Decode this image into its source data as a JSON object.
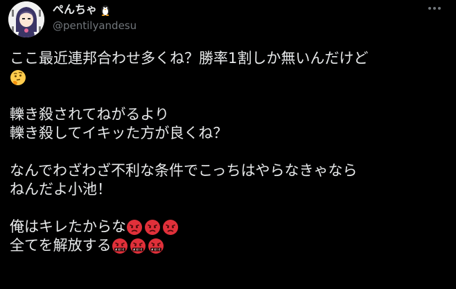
{
  "author": {
    "display_name": "ぺんちゃ",
    "handle": "@pentilyandesu"
  },
  "icons": {
    "penguin": "penguin-emoji",
    "more": "more-options-icon",
    "thinking": "thinking-face-emoji",
    "angry": "angry-face-emoji",
    "cursing": "face-with-symbols-on-mouth-emoji"
  },
  "tweet": {
    "line1": "ここ最近連邦合わせ多くね？勝率1割しか無いんだけど",
    "line2": "轢き殺されてねがるより",
    "line3": "轢き殺してイキッた方が良くね？",
    "line4": "なんでわざわざ不利な条件でこっちはやらなきゃなら",
    "line5": "ねんだよ小池！",
    "line6": "俺はキレたからな",
    "line7": "全てを解放する"
  },
  "colors": {
    "background": "#000000",
    "text": "#e7e9ea",
    "secondary": "#71767b",
    "emoji_red": "#e0303a"
  }
}
